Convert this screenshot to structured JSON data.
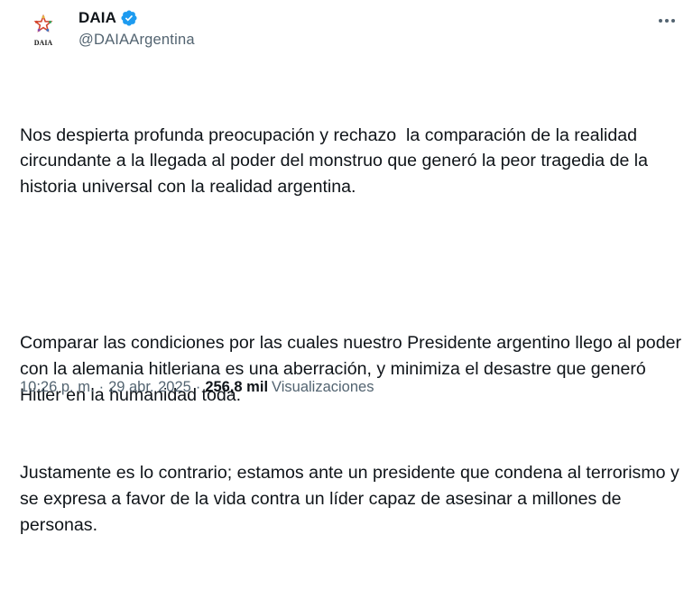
{
  "author": {
    "display_name": "DAIA",
    "handle": "@DAIAArgentina",
    "logo_text": "DAIA",
    "verified": true
  },
  "tweet": {
    "paragraphs": [
      "Nos despierta profunda preocupación y rechazo  la comparación de la realidad circundante a la llegada al poder del monstruo que generó la peor tragedia de la historia universal con la realidad argentina.",
      "Comparar las condiciones por las cuales nuestro Presidente argentino llego al poder con la alemania hitleriana es una aberración, y minimiza el desastre que generó Hitler en la humanidad toda.",
      "Justamente es lo contrario; estamos ante un presidente que condena al terrorismo y se expresa a favor de la vida contra un líder capaz de asesinar a millones de personas."
    ],
    "time": "10:26 p. m.",
    "separator": "·",
    "date": "29 abr. 2025",
    "views_count": "256,8 mil",
    "views_label": "Visualizaciones"
  },
  "icons": {
    "verified": "verified-badge-icon",
    "more": "more-options-icon"
  },
  "colors": {
    "verified_blue": "#1d9bf0",
    "secondary_text": "#536471",
    "primary_text": "#0f1419"
  }
}
